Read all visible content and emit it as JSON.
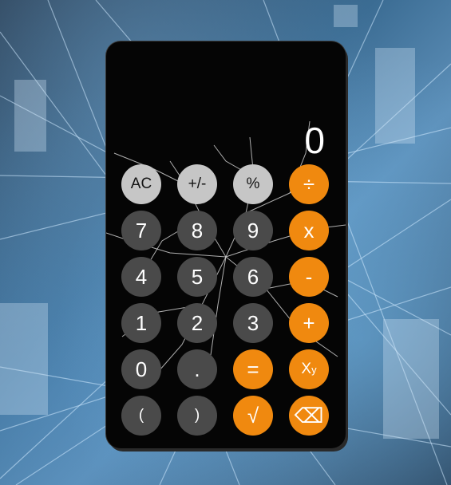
{
  "display": {
    "value": "0"
  },
  "keys": {
    "ac": "AC",
    "sign": "+/-",
    "percent": "%",
    "divide": "÷",
    "seven": "7",
    "eight": "8",
    "nine": "9",
    "multiply": "x",
    "four": "4",
    "five": "5",
    "six": "6",
    "subtract": "-",
    "one": "1",
    "two": "2",
    "three": "3",
    "add": "+",
    "zero": "0",
    "decimal": ".",
    "equals": "=",
    "power_base": "X",
    "power_exp": "y",
    "open_paren": "(",
    "close_paren": ")",
    "sqrt": "√",
    "backspace": "⌫"
  },
  "colors": {
    "light_key": "#c6c6c6",
    "dark_key": "#4a4a4a",
    "operator_key": "#f0890f",
    "body": "#050505"
  }
}
